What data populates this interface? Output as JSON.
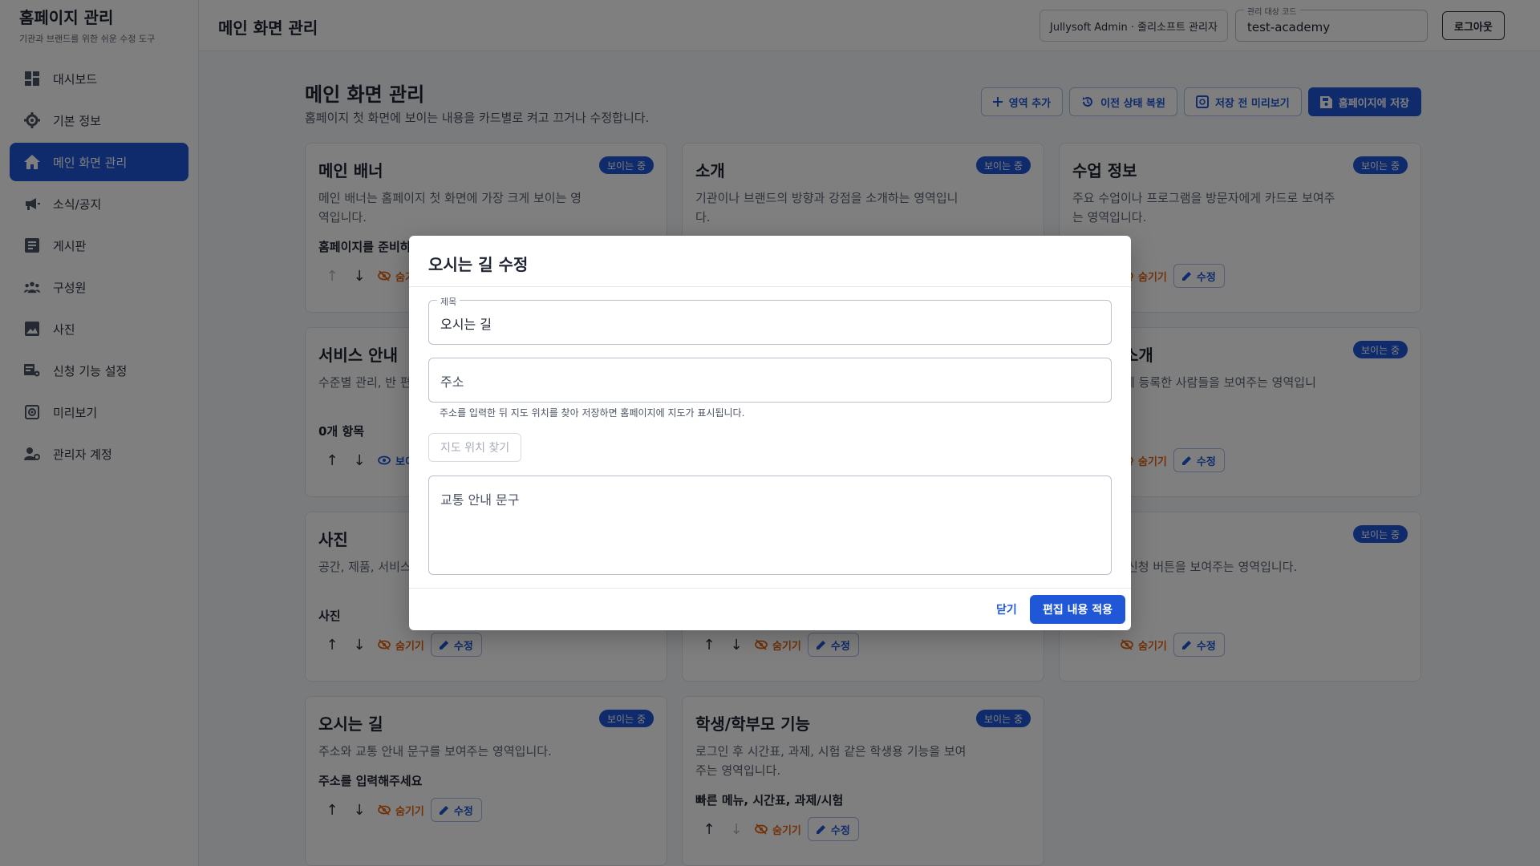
{
  "sidebar": {
    "brand_title": "홈페이지 관리",
    "brand_subtitle": "기관과 브랜드를 위한 쉬운 수정 도구",
    "items": [
      {
        "label": "대시보드",
        "icon": "dashboard-icon"
      },
      {
        "label": "기본 정보",
        "icon": "gear-icon"
      },
      {
        "label": "메인 화면 관리",
        "icon": "home-icon",
        "active": true
      },
      {
        "label": "소식/공지",
        "icon": "megaphone-icon"
      },
      {
        "label": "게시판",
        "icon": "article-icon"
      },
      {
        "label": "구성원",
        "icon": "people-icon"
      },
      {
        "label": "사진",
        "icon": "image-icon"
      },
      {
        "label": "신청 기능 설정",
        "icon": "form-settings-icon"
      },
      {
        "label": "미리보기",
        "icon": "preview-icon"
      },
      {
        "label": "관리자 계정",
        "icon": "admin-account-icon"
      }
    ]
  },
  "topbar": {
    "title": "메인 화면 관리",
    "admin_label": "Jullysoft Admin · 줄리소프트 관리자",
    "code_label": "관리 대상 코드",
    "code_value": "test-academy",
    "logout_label": "로그아웃"
  },
  "main": {
    "title": "메인 화면 관리",
    "description": "홈페이지 첫 화면에 보이는 내용을 카드별로 켜고 끄거나 수정합니다.",
    "actions": {
      "add_section": "영역 추가",
      "restore": "이전 상태 복원",
      "preview": "저장 전 미리보기",
      "save": "홈페이지에 저장"
    },
    "badge_label": "보이는 중",
    "hide_label": "숨기기",
    "show_label": "보이기",
    "edit_label": "수정",
    "cards": [
      {
        "title": "메인 배너",
        "description": "메인 배너는 홈페이지 첫 화면에 가장 크게 보이는 영역입니다.",
        "summary": "홈페이지를 준비하"
      },
      {
        "title": "소개",
        "description": "기관이나 브랜드의 방향과 강점을 소개하는 영역입니다.",
        "summary": ""
      },
      {
        "title": "수업 정보",
        "description": "주요 수업이나 프로그램을 방문자에게 카드로 보여주는 영역입니다.",
        "summary": ""
      },
      {
        "title": "서비스 안내",
        "description": "수준별 관리, 반 편 리스트로 보여주는",
        "summary": "0개 항목"
      },
      {
        "title": "",
        "description": "",
        "summary": ""
      },
      {
        "title": "소개",
        "description": "에 등록한 사람들을 보여주는 영역입니",
        "summary": ""
      },
      {
        "title": "사진",
        "description": "공간, 제품, 서비스 다.",
        "summary": "사진"
      },
      {
        "title": "",
        "description": "",
        "summary": ""
      },
      {
        "title": "",
        "description": "신청 버튼을 보여주는 영역입니다.",
        "summary": ""
      },
      {
        "title": "오시는 길",
        "description": "주소와 교통 안내 문구를 보여주는 영역입니다.",
        "summary": "주소를 입력해주세요"
      },
      {
        "title": "학생/학부모 기능",
        "description": "로그인 후 시간표, 과제, 시험 같은 학생용 기능을 보여주는 영역입니다.",
        "summary": "빠른 메뉴, 시간표, 과제/시험"
      }
    ]
  },
  "modal": {
    "title": "오시는 길 수정",
    "title_field_label": "제목",
    "title_field_value": "오시는 길",
    "address_placeholder": "주소",
    "helper_text": "주소를 입력한 뒤 지도 위치를 찾아 저장하면 홈페이지에 지도가 표시됩니다.",
    "map_button": "지도 위치 찾기",
    "transit_placeholder": "교통 안내 문구",
    "close_label": "닫기",
    "apply_label": "편집 내용 적용"
  },
  "colors": {
    "primary": "#1f57d6",
    "hide_orange": "#e36414",
    "overlay": "rgba(0,0,0,0.5)"
  }
}
